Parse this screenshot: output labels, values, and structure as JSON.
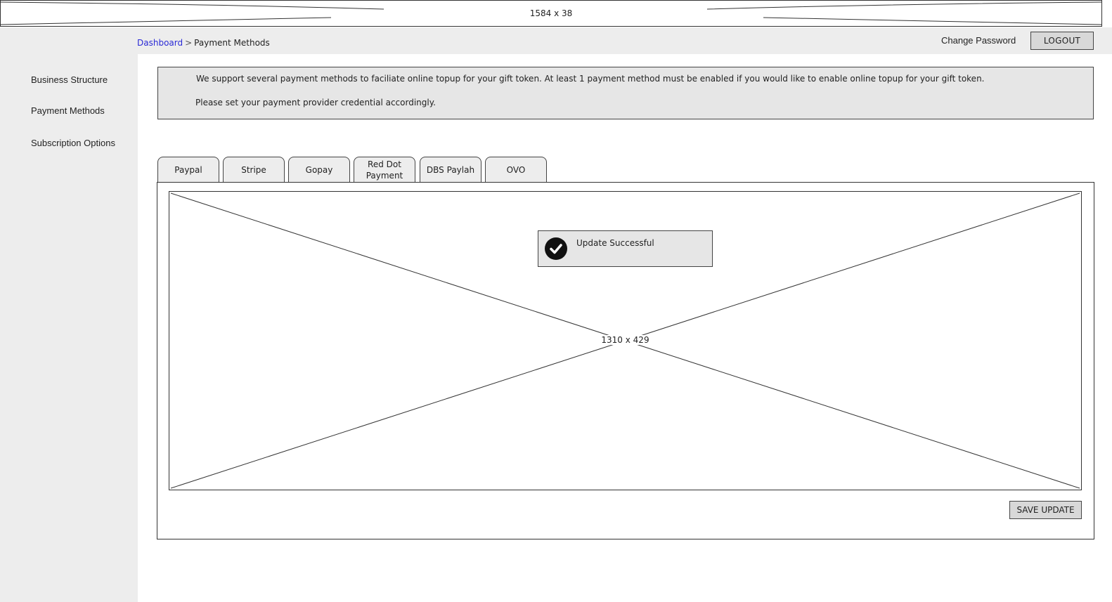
{
  "top_banner": {
    "placeholder_dims": "1584 x 38"
  },
  "sidebar": {
    "items": [
      {
        "label": "Business Structure"
      },
      {
        "label": "Payment Methods"
      },
      {
        "label": "Subscription Options"
      }
    ]
  },
  "header": {
    "breadcrumb": {
      "root": "Dashboard",
      "separator": ">",
      "current": "Payment Methods"
    },
    "change_password": "Change Password",
    "logout": "LOGOUT"
  },
  "info": {
    "line1": "We support several payment methods to faciliate online topup for your gift token. At least 1 payment method must be enabled if you would like to enable online topup for your gift token.",
    "line2": "Please set your payment provider credential accordingly."
  },
  "tabs": [
    {
      "label": "Paypal"
    },
    {
      "label": "Stripe"
    },
    {
      "label": "Gopay"
    },
    {
      "label_line1": "Red Dot",
      "label_line2": "Payment"
    },
    {
      "label": "DBS Paylah"
    },
    {
      "label": "OVO"
    }
  ],
  "panel": {
    "placeholder_dims": "1310 x 429",
    "toast": {
      "message": "Update Successful",
      "icon": "check-circle-icon"
    },
    "save_button": "SAVE UPDATE"
  },
  "colors": {
    "sidebar_bg": "#ededed",
    "box_bg": "#e6e6e6",
    "button_bg": "#d8d8d8",
    "link": "#2a2ad6",
    "border": "#444444"
  }
}
